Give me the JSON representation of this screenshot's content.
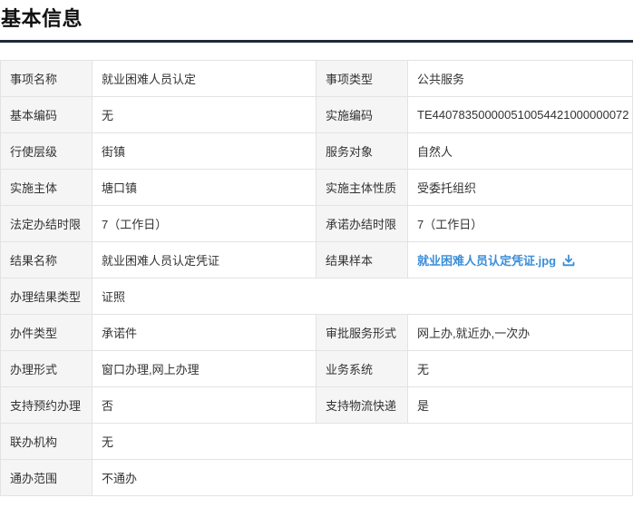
{
  "section": {
    "title": "基本信息"
  },
  "rows": [
    [
      {
        "label": "事项名称",
        "value": "就业困难人员认定"
      },
      {
        "label": "事项类型",
        "value": "公共服务"
      }
    ],
    [
      {
        "label": "基本编码",
        "value": "无"
      },
      {
        "label": "实施编码",
        "value": "TE440783500000510054421000000072"
      }
    ],
    [
      {
        "label": "行使层级",
        "value": "街镇"
      },
      {
        "label": "服务对象",
        "value": "自然人"
      }
    ],
    [
      {
        "label": "实施主体",
        "value": "塘口镇"
      },
      {
        "label": "实施主体性质",
        "value": "受委托组织"
      }
    ],
    [
      {
        "label": "法定办结时限",
        "value": "7（工作日）"
      },
      {
        "label": "承诺办结时限",
        "value": "7（工作日）"
      }
    ],
    [
      {
        "label": "结果名称",
        "value": "就业困难人员认定凭证"
      },
      {
        "label": "结果样本",
        "value": "就业困难人员认定凭证.jpg"
      }
    ],
    [
      {
        "label": "办理结果类型",
        "value": "证照"
      }
    ],
    [
      {
        "label": "办件类型",
        "value": "承诺件"
      },
      {
        "label": "审批服务形式",
        "value": "网上办,就近办,一次办"
      }
    ],
    [
      {
        "label": "办理形式",
        "value": "窗口办理,网上办理"
      },
      {
        "label": "业务系统",
        "value": "无"
      }
    ],
    [
      {
        "label": "支持预约办理",
        "value": "否"
      },
      {
        "label": "支持物流快递",
        "value": "是"
      }
    ],
    [
      {
        "label": "联办机构",
        "value": "无"
      }
    ],
    [
      {
        "label": "通办范围",
        "value": "不通办"
      }
    ]
  ],
  "icons": {
    "download": "download-icon"
  },
  "colors": {
    "header_rule": "#1e2a38",
    "label_bg": "#f5f5f5",
    "border": "#e3e3e3",
    "link": "#3a8ed8"
  }
}
